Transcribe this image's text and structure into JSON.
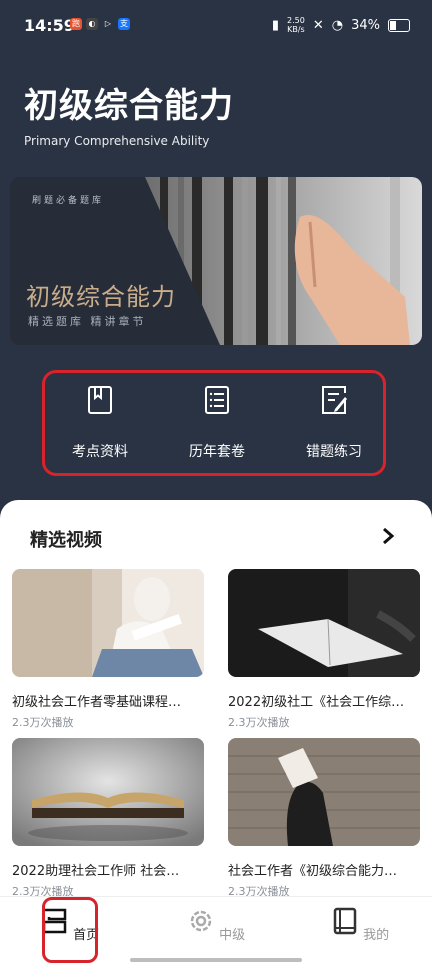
{
  "status": {
    "time": "14:59",
    "net_speed": "2.50\nKB/s",
    "battery": "34%"
  },
  "header": {
    "title": "初级综合能力",
    "subtitle": "Primary Comprehensive Ability"
  },
  "banner": {
    "tag": "刷题必备题库",
    "title": "初级综合能力",
    "subtitle": "精选题库  精讲章节"
  },
  "features": [
    {
      "label": "考点资料",
      "icon": "bookmark-book-icon"
    },
    {
      "label": "历年套卷",
      "icon": "list-document-icon"
    },
    {
      "label": "错题练习",
      "icon": "edit-document-icon"
    }
  ],
  "videos": {
    "section_title": "精选视频",
    "items": [
      {
        "title": "初级社会工作者零基础课程…",
        "plays": "2.3万次播放"
      },
      {
        "title": "2022初级社工《社会工作综…",
        "plays": "2.3万次播放"
      },
      {
        "title": "2022助理社会工作师 社会…",
        "plays": "2.3万次播放"
      },
      {
        "title": "社会工作者《初级综合能力…",
        "plays": "2.3万次播放"
      }
    ]
  },
  "tabbar": {
    "home": "首页",
    "middle": "中级",
    "mine": "我的"
  },
  "colors": {
    "header_bg": "#2a3344",
    "highlight": "#d8232a",
    "banner_text": "#c9ad8b"
  }
}
